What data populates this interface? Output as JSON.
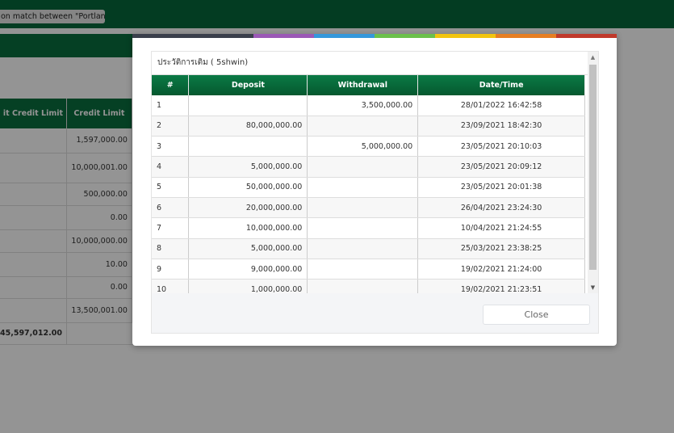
{
  "topbar": {
    "notice": "on match between \"Portland Ti"
  },
  "background_table": {
    "columns": [
      "it Credit Limit",
      "Credit Limit"
    ],
    "rows": [
      {
        "credit_limit": "1,597,000.00",
        "height": 30
      },
      {
        "credit_limit": "10,000,001.00",
        "height": 37
      },
      {
        "credit_limit": "500,000.00",
        "height": 28
      },
      {
        "credit_limit": "0.00",
        "height": 30
      },
      {
        "credit_limit": "10,000,000.00",
        "height": 28
      },
      {
        "credit_limit": "10.00",
        "height": 30
      },
      {
        "credit_limit": "0.00",
        "height": 27
      },
      {
        "credit_limit": "13,500,001.00",
        "height": 30
      }
    ],
    "total": "45,597,012.00"
  },
  "modal": {
    "stripe_colors": [
      "#3a3f4b",
      "#3a3f4b",
      "#9b59b6",
      "#3498db",
      "#6bc04b",
      "#f1c40f",
      "#e67e22",
      "#c0392b"
    ],
    "caption": "ประวัติการเติม ( 5shwin)",
    "columns": [
      "#",
      "Deposit",
      "Withdrawal",
      "Date/Time"
    ],
    "rows": [
      {
        "no": "1",
        "deposit": "",
        "withdrawal": "3,500,000.00",
        "datetime": "28/01/2022 16:42:58"
      },
      {
        "no": "2",
        "deposit": "80,000,000.00",
        "withdrawal": "",
        "datetime": "23/09/2021 18:42:30"
      },
      {
        "no": "3",
        "deposit": "",
        "withdrawal": "5,000,000.00",
        "datetime": "23/05/2021 20:10:03"
      },
      {
        "no": "4",
        "deposit": "5,000,000.00",
        "withdrawal": "",
        "datetime": "23/05/2021 20:09:12"
      },
      {
        "no": "5",
        "deposit": "50,000,000.00",
        "withdrawal": "",
        "datetime": "23/05/2021 20:01:38"
      },
      {
        "no": "6",
        "deposit": "20,000,000.00",
        "withdrawal": "",
        "datetime": "26/04/2021 23:24:30"
      },
      {
        "no": "7",
        "deposit": "10,000,000.00",
        "withdrawal": "",
        "datetime": "10/04/2021 21:24:55"
      },
      {
        "no": "8",
        "deposit": "5,000,000.00",
        "withdrawal": "",
        "datetime": "25/03/2021 23:38:25"
      },
      {
        "no": "9",
        "deposit": "9,000,000.00",
        "withdrawal": "",
        "datetime": "19/02/2021 21:24:00"
      },
      {
        "no": "10",
        "deposit": "1,000,000.00",
        "withdrawal": "",
        "datetime": "19/02/2021 21:23:51"
      }
    ],
    "scroll_up_icon": "triangle-up-icon",
    "scroll_down_icon": "triangle-down-icon",
    "close_label": "Close"
  }
}
